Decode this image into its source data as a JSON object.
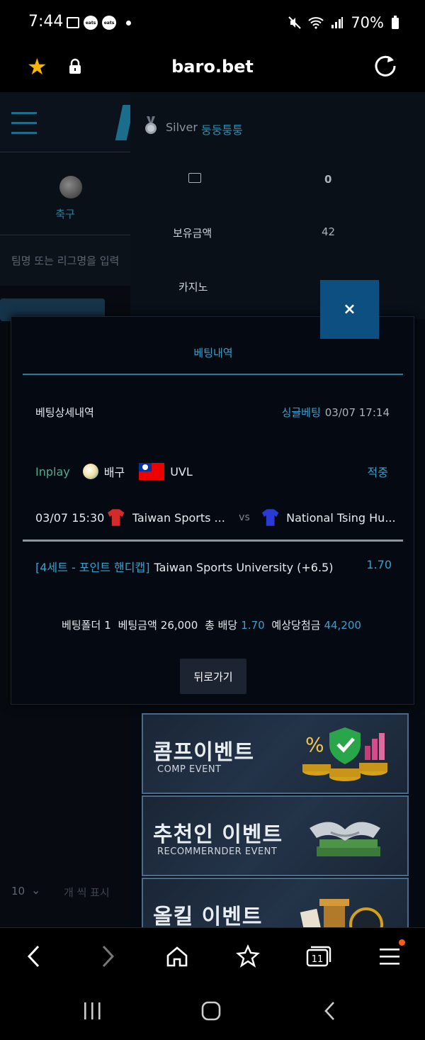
{
  "status_bar": {
    "time": "7:44",
    "app_icon_1": "eats",
    "app_icon_2": "eats",
    "battery": "70%"
  },
  "browser": {
    "url": "baro.bet",
    "tab_count": "11"
  },
  "left_panel": {
    "sport_label": "축구",
    "search_placeholder": "팀명 또는 리그명을 입력",
    "page_size": "10",
    "page_size_suffix": "개 씩 표시"
  },
  "account": {
    "level": "Silver",
    "username": "둥둥퉁퉁",
    "messages": "0",
    "balance_label": "보유금액",
    "balance_value": "42",
    "casino_label": "카지노"
  },
  "modal": {
    "close_label": "×",
    "tab_label": "베팅내역",
    "header_title": "베팅상세내역",
    "bet_type": "싱글베팅",
    "bet_datetime": "03/07 17:14",
    "status": "Inplay",
    "sport": "배구",
    "league": "UVL",
    "result": "적중",
    "match_time": "03/07 15:30",
    "home_team": "Taiwan Sports ...",
    "vs": "vs",
    "away_team": "National Tsing Hu...",
    "pick_market": "[4세트 - 포인트 핸디캡]",
    "pick_selection": "Taiwan Sports University (+6.5)",
    "pick_odds": "1.70",
    "summary": {
      "folder_label": "베팅폴더",
      "folder_value": "1",
      "amount_label": "베팅금액",
      "amount_value": "26,000",
      "odds_label": "총 배당",
      "odds_value": "1.70",
      "payout_label": "예상당첨금",
      "payout_value": "44,200"
    },
    "back_label": "뒤로가기"
  },
  "banners": [
    {
      "title": "콤프이벤트",
      "subtitle": "COMP EVENT"
    },
    {
      "title": "추천인 이벤트",
      "subtitle": "RECOMMERNDER EVENT"
    },
    {
      "title": "올킬 이벤트",
      "subtitle": ""
    }
  ],
  "colors": {
    "accent": "#3aa0cc",
    "inplay": "#4caf8f",
    "close_button": "#0d4f80"
  }
}
